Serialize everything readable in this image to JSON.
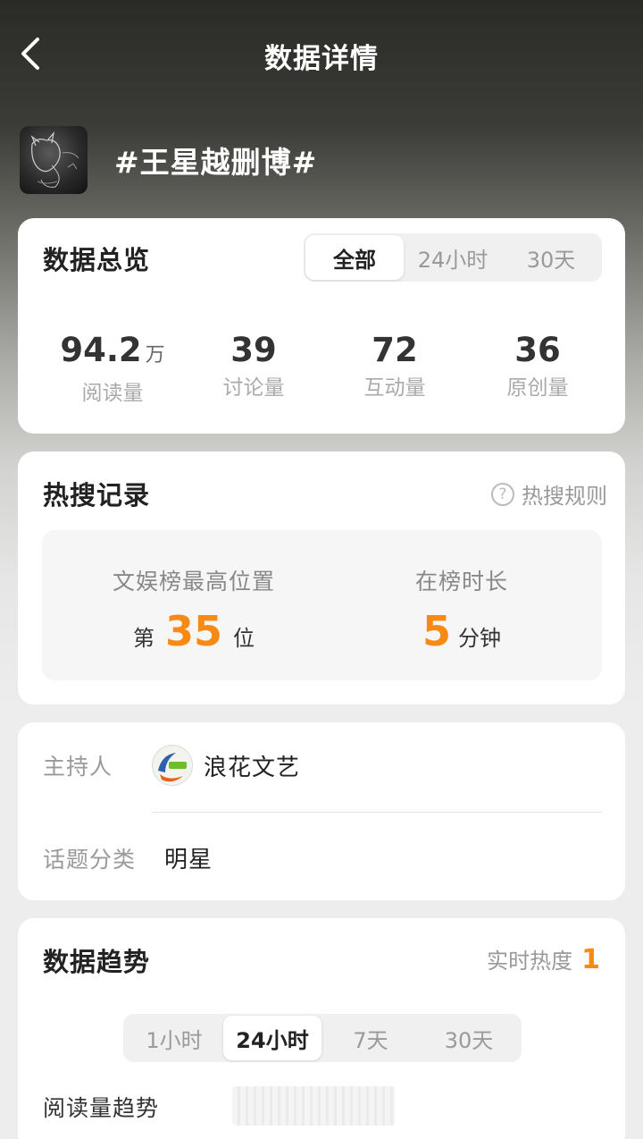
{
  "header": {
    "title": "数据详情"
  },
  "topic": {
    "title": "#王星越删博#"
  },
  "overview": {
    "title": "数据总览",
    "tabs": [
      {
        "label": "全部",
        "active": true
      },
      {
        "label": "24小时",
        "active": false
      },
      {
        "label": "30天",
        "active": false
      }
    ],
    "stats": [
      {
        "value": "94.2",
        "unit": "万",
        "label": "阅读量"
      },
      {
        "value": "39",
        "unit": "",
        "label": "讨论量"
      },
      {
        "value": "72",
        "unit": "",
        "label": "互动量"
      },
      {
        "value": "36",
        "unit": "",
        "label": "原创量"
      }
    ]
  },
  "hot_search": {
    "title": "热搜记录",
    "rules_link": "热搜规则",
    "rules_icon": "?",
    "best_rank": {
      "label": "文娱榜最高位置",
      "prefix": "第",
      "value": "35",
      "suffix": "位"
    },
    "duration": {
      "label": "在榜时长",
      "value": "5",
      "suffix": "分钟"
    }
  },
  "info": {
    "host_label": "主持人",
    "host_name": "浪花文艺",
    "category_label": "话题分类",
    "category_value": "明星"
  },
  "trend": {
    "title": "数据趋势",
    "realtime_label": "实时热度",
    "realtime_value": "1",
    "tabs": [
      {
        "label": "1小时",
        "active": false
      },
      {
        "label": "24小时",
        "active": true
      },
      {
        "label": "7天",
        "active": false
      },
      {
        "label": "30天",
        "active": false
      }
    ],
    "subtitle": "阅读量趋势"
  },
  "colors": {
    "accent": "#f78a14",
    "card": "#ffffff",
    "text": "#222222",
    "muted": "#999999"
  },
  "icons": {
    "back": "chevron-left-icon",
    "help": "question-circle-icon"
  }
}
